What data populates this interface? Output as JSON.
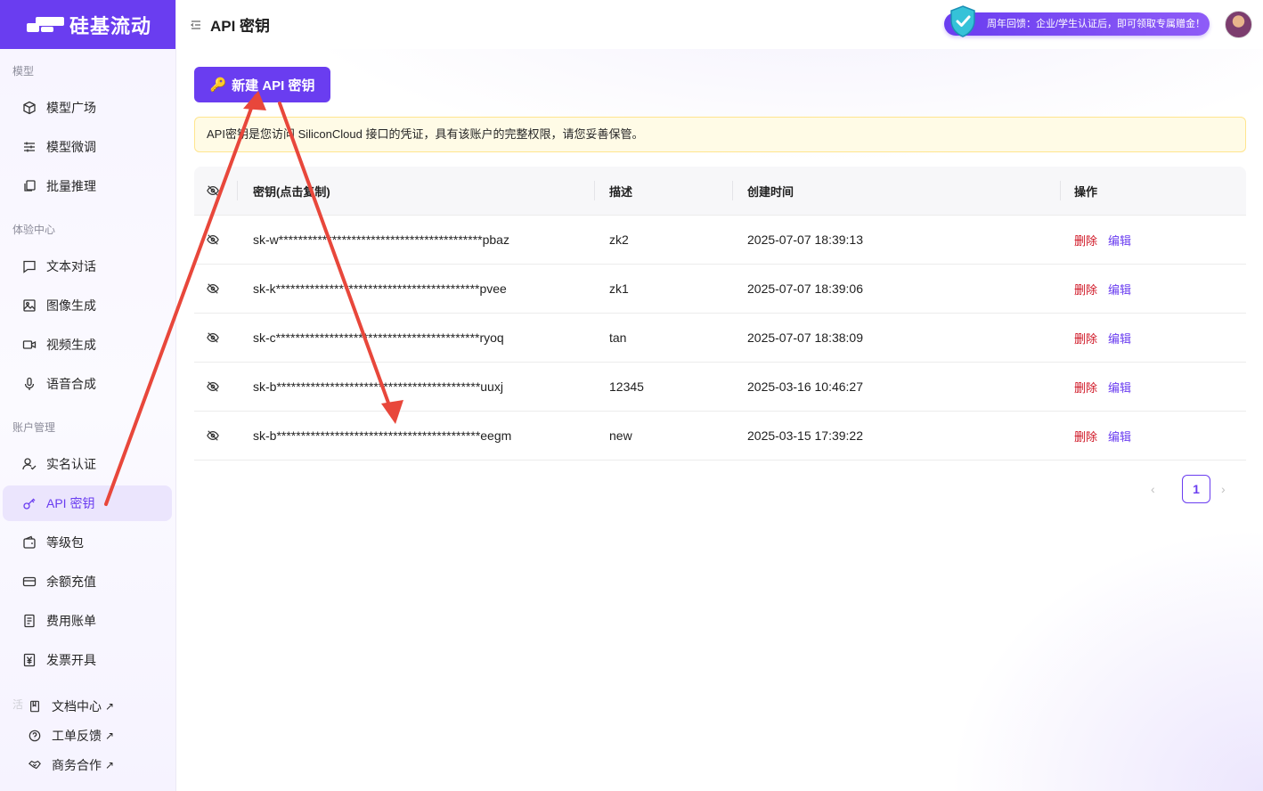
{
  "brand": {
    "name": "硅基流动"
  },
  "sidebar": {
    "sections": [
      {
        "title": "模型"
      },
      {
        "title": "体验中心"
      },
      {
        "title": "账户管理"
      },
      {
        "title": "活"
      }
    ],
    "items": [
      {
        "label": "模型广场",
        "icon": "cube-icon"
      },
      {
        "label": "模型微调",
        "icon": "sliders-icon"
      },
      {
        "label": "批量推理",
        "icon": "stack-icon"
      },
      {
        "label": "文本对话",
        "icon": "chat-icon"
      },
      {
        "label": "图像生成",
        "icon": "image-icon"
      },
      {
        "label": "视频生成",
        "icon": "video-icon"
      },
      {
        "label": "语音合成",
        "icon": "mic-icon"
      },
      {
        "label": "实名认证",
        "icon": "user-check-icon"
      },
      {
        "label": "API 密钥",
        "icon": "key-icon",
        "active": true
      },
      {
        "label": "等级包",
        "icon": "wallet-icon"
      },
      {
        "label": "余额充值",
        "icon": "card-icon"
      },
      {
        "label": "费用账单",
        "icon": "bill-icon"
      },
      {
        "label": "发票开具",
        "icon": "yen-icon"
      },
      {
        "label": "文档中心",
        "icon": "book-icon",
        "external": "↗"
      },
      {
        "label": "工单反馈",
        "icon": "help-icon",
        "external": "↗"
      },
      {
        "label": "商务合作",
        "icon": "handshake-icon",
        "external": "↗"
      }
    ]
  },
  "header": {
    "title": "API 密钥",
    "promo": "周年回馈：企业/学生认证后，即可领取专属赠金！"
  },
  "main": {
    "new_button": "新建 API 密钥",
    "notice": "API密钥是您访问 SiliconCloud 接口的凭证，具有该账户的完整权限，请您妥善保管。",
    "table": {
      "columns": [
        "密钥(点击复制)",
        "描述",
        "创建时间",
        "操作"
      ],
      "rows": [
        {
          "key": "sk-w******************************************pbaz",
          "desc": "zk2",
          "time": "2025-07-07 18:39:13",
          "del": "删除",
          "edit": "编辑"
        },
        {
          "key": "sk-k******************************************pvee",
          "desc": "zk1",
          "time": "2025-07-07 18:39:06",
          "del": "删除",
          "edit": "编辑"
        },
        {
          "key": "sk-c******************************************ryoq",
          "desc": "tan",
          "time": "2025-07-07 18:38:09",
          "del": "删除",
          "edit": "编辑"
        },
        {
          "key": "sk-b******************************************uuxj",
          "desc": "12345",
          "time": "2025-03-16 10:46:27",
          "del": "删除",
          "edit": "编辑"
        },
        {
          "key": "sk-b******************************************eegm",
          "desc": "new",
          "time": "2025-03-15 17:39:22",
          "del": "删除",
          "edit": "编辑"
        }
      ]
    },
    "pagination": {
      "prev": "‹",
      "current": "1",
      "next": "›"
    }
  },
  "colors": {
    "accent": "#6a3df0",
    "danger": "#cf1322",
    "annotation": "#e8473b"
  }
}
